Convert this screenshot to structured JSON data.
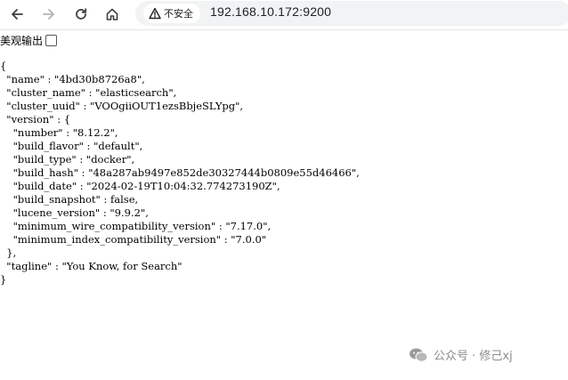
{
  "browser": {
    "nav": {
      "back_icon": "arrow-left-icon",
      "forward_icon": "arrow-right-icon",
      "reload_icon": "reload-icon",
      "home_icon": "home-icon"
    },
    "security_label": "不安全",
    "url": "192.168.10.172:9200"
  },
  "pretty_print": {
    "label": "美观输出",
    "checked": false
  },
  "json_response": {
    "text": "{\n  \"name\" : \"4bd30b8726a8\",\n  \"cluster_name\" : \"elasticsearch\",\n  \"cluster_uuid\" : \"VOOgiiOUT1ezsBbjeSLYpg\",\n  \"version\" : {\n    \"number\" : \"8.12.2\",\n    \"build_flavor\" : \"default\",\n    \"build_type\" : \"docker\",\n    \"build_hash\" : \"48a287ab9497e852de30327444b0809e55d46466\",\n    \"build_date\" : \"2024-02-19T10:04:32.774273190Z\",\n    \"build_snapshot\" : false,\n    \"lucene_version\" : \"9.9.2\",\n    \"minimum_wire_compatibility_version\" : \"7.17.0\",\n    \"minimum_index_compatibility_version\" : \"7.0.0\"\n  },\n  \"tagline\" : \"You Know, for Search\"\n}"
  },
  "watermark": {
    "text": "公众号 · 修己xj"
  }
}
